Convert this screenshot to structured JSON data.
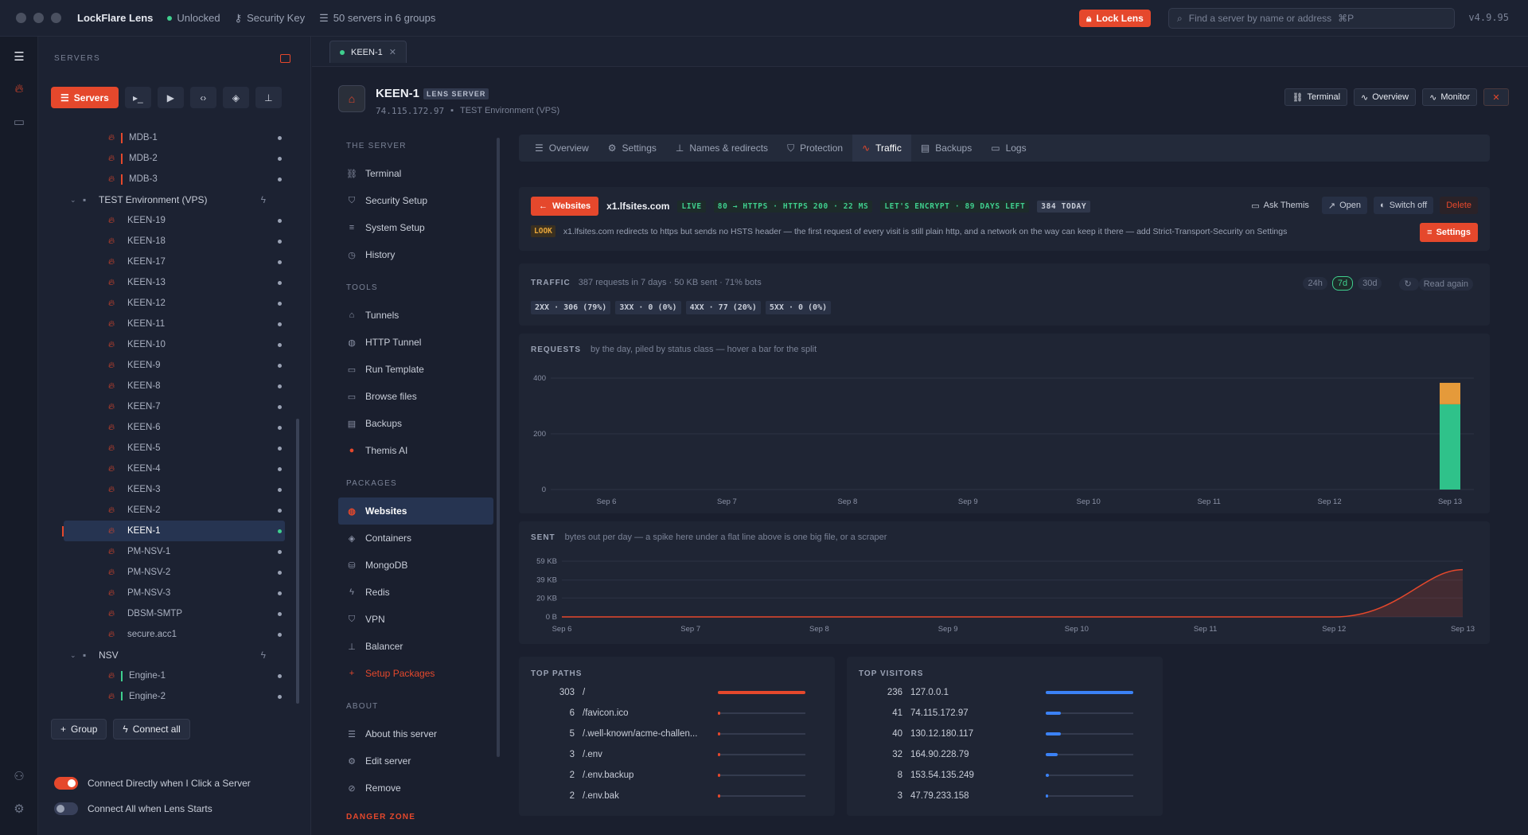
{
  "app": {
    "title": "LockFlare Lens",
    "lock_state": "Unlocked",
    "key_label": "Security Key",
    "servers_summary": "50 servers in 6 groups",
    "lock_button": "Lock Lens",
    "search_placeholder": "Find a server by name or address",
    "search_shortcut": "⌘P",
    "version": "v4.9.95"
  },
  "sidebar": {
    "heading": "SERVERS",
    "servers_button": "Servers",
    "groups": [
      {
        "name": "TEST Environment (VPS)"
      },
      {
        "name": "NSV"
      }
    ],
    "mdb": [
      "MDB-1",
      "MDB-2",
      "MDB-3"
    ],
    "test_env": [
      "KEEN-19",
      "KEEN-18",
      "KEEN-17",
      "KEEN-13",
      "KEEN-12",
      "KEEN-11",
      "KEEN-10",
      "KEEN-9",
      "KEEN-8",
      "KEEN-7",
      "KEEN-6",
      "KEEN-5",
      "KEEN-4",
      "KEEN-3",
      "KEEN-2",
      "KEEN-1",
      "PM-NSV-1",
      "PM-NSV-2",
      "PM-NSV-3",
      "DBSM-SMTP",
      "secure.acc1"
    ],
    "nsv": [
      "Engine-1",
      "Engine-2"
    ],
    "group_button": "Group",
    "connect_all_button": "Connect all",
    "toggle_connect_direct": "Connect Directly when I Click a Server",
    "toggle_connect_start": "Connect All when Lens Starts"
  },
  "tab": {
    "label": "KEEN-1"
  },
  "server": {
    "name": "KEEN-1",
    "badge": "LENS SERVER",
    "ip": "74.115.172.97",
    "group": "TEST Environment (VPS)",
    "buttons": {
      "terminal": "Terminal",
      "overview": "Overview",
      "monitor": "Monitor"
    }
  },
  "nav": {
    "the_server": "THE SERVER",
    "server_items": [
      "Terminal",
      "Security Setup",
      "System Setup",
      "History"
    ],
    "tools": "TOOLS",
    "tool_items": [
      "Tunnels",
      "HTTP Tunnel",
      "Run Template",
      "Browse files",
      "Backups",
      "Themis AI"
    ],
    "packages": "PACKAGES",
    "package_items": [
      "Websites",
      "Containers",
      "MongoDB",
      "Redis",
      "VPN",
      "Balancer"
    ],
    "setup_packages": "Setup Packages",
    "about": "ABOUT",
    "about_items": [
      "About this server",
      "Edit server",
      "Remove"
    ],
    "danger": "DANGER ZONE"
  },
  "subtabs": [
    "Overview",
    "Settings",
    "Names & redirects",
    "Protection",
    "Traffic",
    "Backups",
    "Logs"
  ],
  "site": {
    "websites_button": "Websites",
    "host": "x1.lfsites.com",
    "chips": [
      "LIVE",
      "80 → HTTPS · HTTPS 200 · 22 MS",
      "LET'S ENCRYPT · 89 DAYS LEFT",
      "384 TODAY"
    ],
    "actions": {
      "ask": "Ask Themis",
      "open": "Open",
      "switch_off": "Switch off",
      "delete": "Delete"
    },
    "look_chip": "LOOK",
    "look_text": "x1.lfsites.com redirects to https but sends no HSTS header — the first request of every visit is still plain http, and a network on the way can keep it there — add Strict-Transport-Security on Settings",
    "settings_button": "Settings"
  },
  "traffic": {
    "label": "TRAFFIC",
    "summary": "387 requests in 7 days · 50 KB sent · 71% bots",
    "status": [
      "2XX · 306 (79%)",
      "3XX · 0 (0%)",
      "4XX · 77 (20%)",
      "5XX · 0 (0%)"
    ],
    "ranges": [
      "24h",
      "7d",
      "30d"
    ],
    "read_again": "Read again"
  },
  "requests_label": "REQUESTS",
  "requests_note": "by the day, piled by status class — hover a bar for the split",
  "sent_label": "SENT",
  "sent_note": "bytes out per day — a spike here under a flat line above is one big file, or a scraper",
  "chart_data": [
    {
      "type": "bar",
      "stacked": true,
      "categories": [
        "Sep 6",
        "Sep 7",
        "Sep 8",
        "Sep 9",
        "Sep 10",
        "Sep 11",
        "Sep 12",
        "Sep 13"
      ],
      "series": [
        {
          "values": [
            0,
            0,
            0,
            0,
            0,
            0,
            0,
            306
          ],
          "color": "#2fc28a"
        },
        {
          "values": [
            0,
            0,
            0,
            0,
            0,
            0,
            0,
            77
          ],
          "color": "#e59a3a"
        }
      ],
      "ylim": [
        0,
        400
      ],
      "yticks": [
        "400",
        "200",
        "0"
      ]
    },
    {
      "type": "area",
      "x": [
        "Sep 6",
        "Sep 7",
        "Sep 8",
        "Sep 9",
        "Sep 10",
        "Sep 11",
        "Sep 12",
        "Sep 13"
      ],
      "values_kb": [
        0,
        0,
        0,
        0,
        0,
        0,
        0,
        50
      ],
      "yticks": [
        "59 KB",
        "39 KB",
        "20 KB",
        "0 B"
      ],
      "ylim": [
        0,
        59
      ],
      "color": "#e5482c"
    }
  ],
  "top_paths": {
    "label": "TOP PATHS",
    "rows": [
      {
        "count": "303",
        "name": "/",
        "share": 1.0
      },
      {
        "count": "6",
        "name": "/favicon.ico",
        "share": 0.02
      },
      {
        "count": "5",
        "name": "/.well-known/acme-challen...",
        "share": 0.017
      },
      {
        "count": "3",
        "name": "/.env",
        "share": 0.01
      },
      {
        "count": "2",
        "name": "/.env.backup",
        "share": 0.007
      },
      {
        "count": "2",
        "name": "/.env.bak",
        "share": 0.007
      }
    ]
  },
  "top_visitors": {
    "label": "TOP VISITORS",
    "rows": [
      {
        "count": "236",
        "name": "127.0.0.1",
        "share": 1.0
      },
      {
        "count": "41",
        "name": "74.115.172.97",
        "share": 0.17
      },
      {
        "count": "40",
        "name": "130.12.180.117",
        "share": 0.17
      },
      {
        "count": "32",
        "name": "164.90.228.79",
        "share": 0.136
      },
      {
        "count": "8",
        "name": "153.54.135.249",
        "share": 0.034
      },
      {
        "count": "3",
        "name": "47.79.233.158",
        "share": 0.013
      }
    ]
  }
}
